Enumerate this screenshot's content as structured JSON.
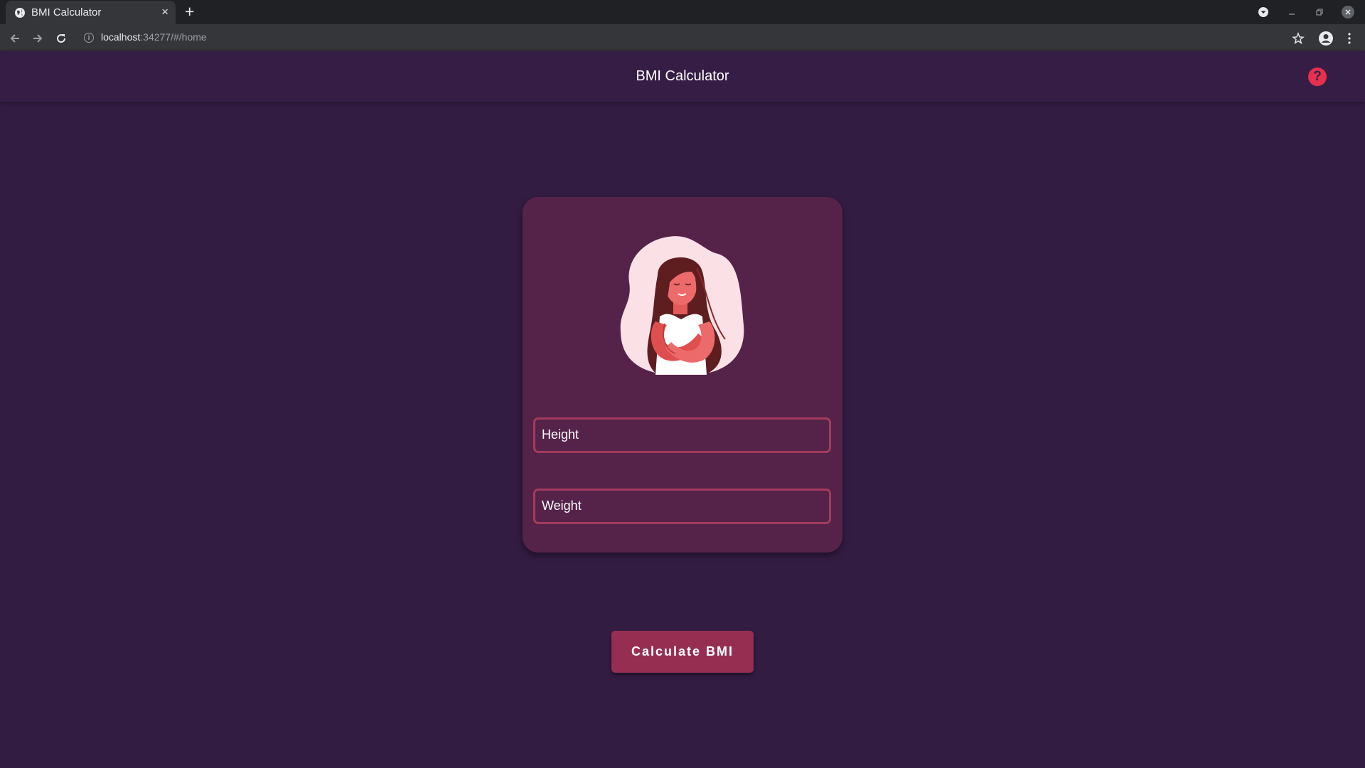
{
  "browser": {
    "tab_title": "BMI Calculator",
    "tab_close": "×",
    "new_tab": "+",
    "url_host": "localhost",
    "url_rest": ":34277/#/home"
  },
  "app": {
    "title": "BMI Calculator",
    "help_glyph": "?",
    "accent_color": "#e5304e",
    "background_color": "#331c42",
    "card_color": "#55234a"
  },
  "form": {
    "height_label": "Height",
    "weight_label": "Weight"
  },
  "actions": {
    "calculate_label": "Calculate BMI"
  }
}
